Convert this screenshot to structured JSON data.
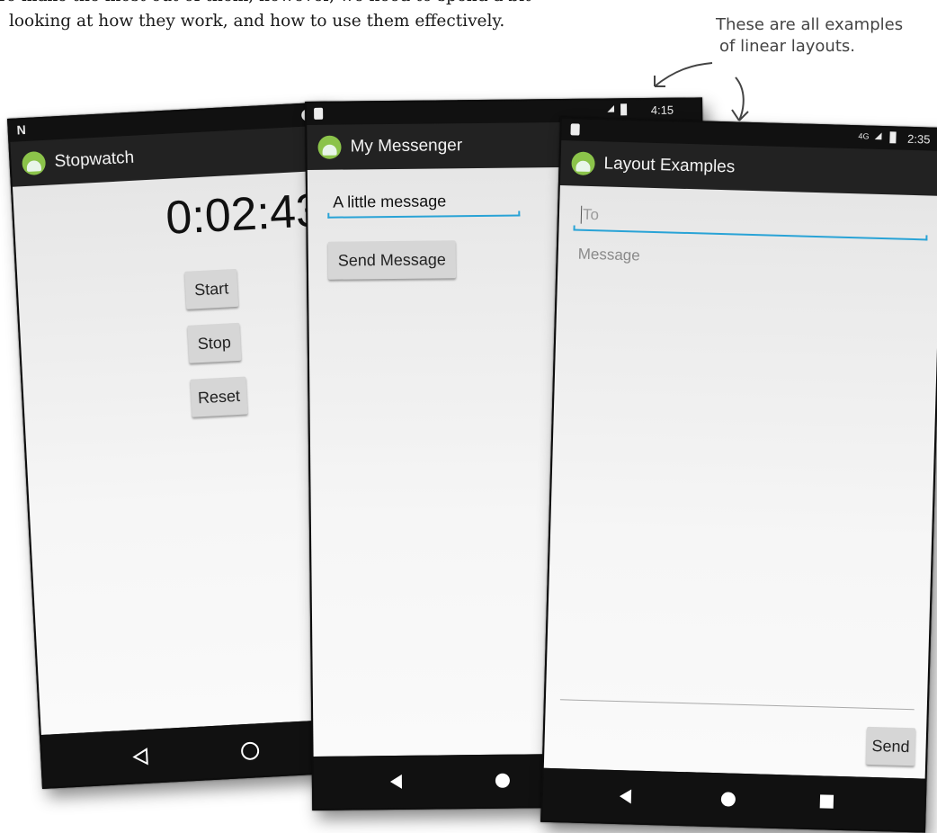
{
  "intro": {
    "line1": "To make the most out of them, however, we need to spend a bit",
    "line2": "looking at how they work, and how to use them effectively."
  },
  "annotation": {
    "line1": "These are all examples",
    "line2": "of linear layouts."
  },
  "colors": {
    "accent": "#29a3d6",
    "button": "#d6d6d6",
    "appbar": "#222222",
    "statusbar": "#111111"
  },
  "stopwatch": {
    "title": "Stopwatch",
    "status_icon": "notification-n-icon",
    "time": "0:02:43",
    "buttons": [
      "Start",
      "Stop",
      "Reset"
    ],
    "nav_icons": [
      "back-icon",
      "home-icon"
    ]
  },
  "messenger": {
    "status_time": "4:15",
    "title": "My Messenger",
    "input_value": "A little message",
    "send_label": "Send Message",
    "nav_icons": [
      "back-icon",
      "home-icon"
    ]
  },
  "layout_examples": {
    "status_time": "2:35",
    "network": "4G",
    "title": "Layout Examples",
    "to_placeholder": "To",
    "message_placeholder": "Message",
    "send_label": "Send",
    "nav_icons": [
      "back-icon",
      "home-icon",
      "recents-icon"
    ]
  }
}
